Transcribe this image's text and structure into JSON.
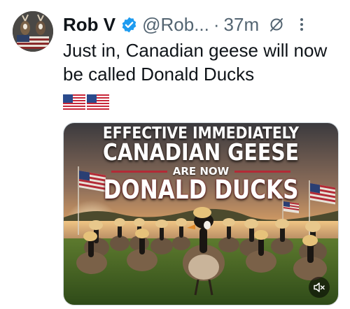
{
  "author": {
    "name": "Rob V",
    "handle": "@Rob...",
    "separator": "·",
    "time": "37m",
    "verified": true
  },
  "tweet": {
    "text": "Just in, Canadian geese will now be called Donald Ducks",
    "emoji_flags": [
      "us-flag",
      "us-flag"
    ]
  },
  "media": {
    "headline_1": "EFFECTIVE IMMEDIATELY",
    "headline_2": "CANADIAN GEESE",
    "headline_3": "ARE NOW",
    "headline_4": "DONALD DUCKS",
    "video_muted": true
  },
  "icons": {
    "verified": "verified-badge-icon",
    "grok": "grok-icon",
    "more": "more-icon",
    "mute": "volume-mute-icon"
  },
  "colors": {
    "verified_blue": "#1d9bf0",
    "text_primary": "#0f1419",
    "text_secondary": "#536471",
    "headline_red": "#b32a36"
  }
}
